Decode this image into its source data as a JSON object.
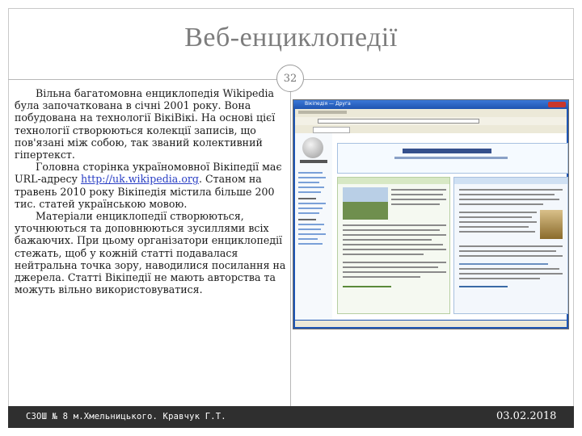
{
  "slide": {
    "title": "Веб-енциклопедії",
    "page_number": "32",
    "paragraphs": [
      {
        "text_before": "Вільна багатомовна енциклопедія Wikipedia була започаткована в січні 2001 року. Вона побудована на технології ВікіВікі. На основі цієї технології створюються колекції записів, що пов'язані між собою, так званий колективний гіпертекст."
      },
      {
        "text_before": "Головна сторінка україномовної Вікіпедії має URL-адресу ",
        "link": "http://uk.wikipedia.org",
        "text_after": ". Станом на травень 2010 року Вікіпедія містила більше 200 тис. статей українською мовою."
      },
      {
        "text_before": "Матеріали енциклопедії створюються, уточнюються та доповнюються зусиллями всіх бажаючих. При цьому організатори енциклопедії стежать, щоб у кожній статті подавалася нейтральна точка зору, наводилися посилання на джерела. Статті Вікіпедії не мають авторства та можуть вільно використовуватися."
      }
    ],
    "footer_left": "СЗОШ № 8 м.Хмельницького. Кравчук Г.Т.",
    "footer_right": "03.02.2018"
  },
  "screenshot": {
    "window_title": "Вікіпедія — Друга",
    "tab_label": "Вікіпедія",
    "welcome_heading": "Ласкаво просимо до Вікіпедії",
    "logo_text": "Вікіпедія"
  },
  "colors": {
    "title": "#7d7d7d",
    "footer_band": "#2f2f2f",
    "link": "#2a3fc4"
  }
}
